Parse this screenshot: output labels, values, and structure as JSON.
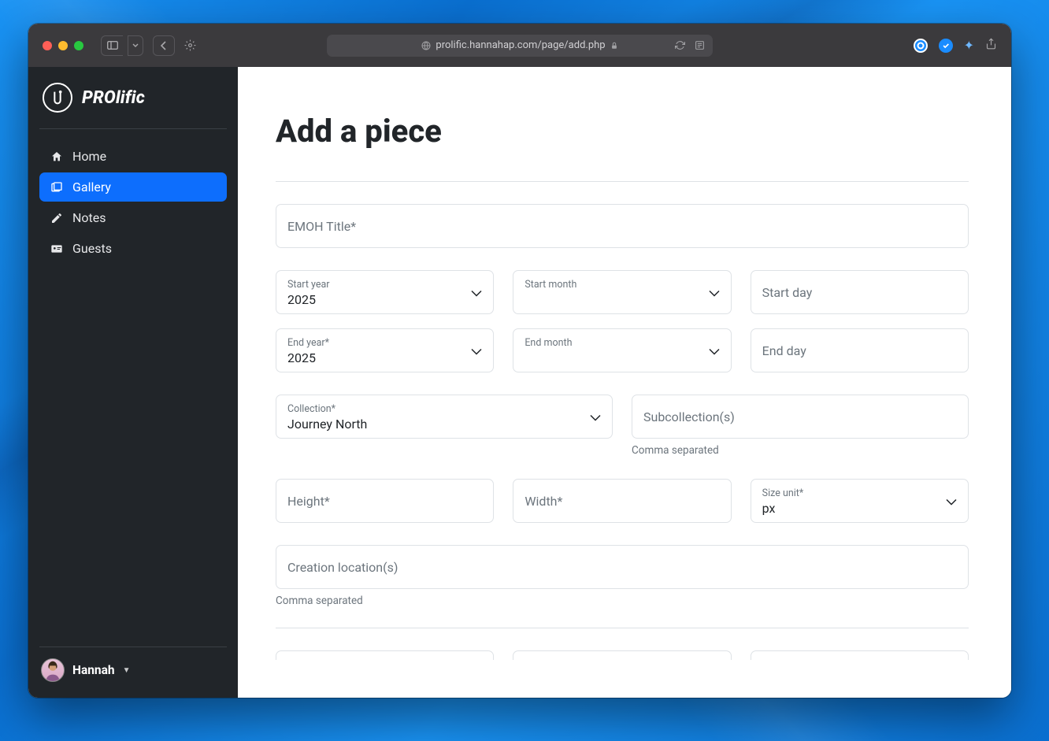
{
  "browser": {
    "url": "prolific.hannahap.com/page/add.php"
  },
  "brand": {
    "name": "PROlific"
  },
  "sidebar": {
    "items": [
      {
        "label": "Home"
      },
      {
        "label": "Gallery"
      },
      {
        "label": "Notes"
      },
      {
        "label": "Guests"
      }
    ]
  },
  "user": {
    "name": "Hannah"
  },
  "page": {
    "title": "Add a piece"
  },
  "form": {
    "title_placeholder": "EMOH Title*",
    "start_year_label": "Start year",
    "start_year_value": "2025",
    "start_month_label": "Start month",
    "start_day_placeholder": "Start day",
    "end_year_label": "End year*",
    "end_year_value": "2025",
    "end_month_label": "End month",
    "end_day_placeholder": "End day",
    "collection_label": "Collection*",
    "collection_value": "Journey North",
    "subcollection_placeholder": "Subcollection(s)",
    "subcollection_helper": "Comma separated",
    "height_placeholder": "Height*",
    "width_placeholder": "Width*",
    "size_unit_label": "Size unit*",
    "size_unit_value": "px",
    "creation_location_placeholder": "Creation location(s)",
    "creation_location_helper": "Comma separated"
  }
}
